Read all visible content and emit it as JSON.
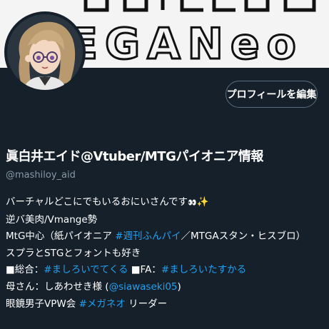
{
  "banner": {
    "logo_text": "EGANeo"
  },
  "profile": {
    "edit_button_label": "プロフィールを編集",
    "display_name": "眞白井エイド@Vtuber/MTGパイオニア情報",
    "handle": "@mashiloy_aid"
  },
  "bio": {
    "line1_text": "バーチャルどこにでもいるおにいさんです",
    "line1_emoji_eyes": "👀",
    "line1_emoji_sparkle": "✨",
    "line2": "逆バ美肉/Vmange勢",
    "line3_pre": "MtG中心（紙パイオニア ",
    "line3_link": "#週刊ふんパイ",
    "line3_post": "／MTGAスタン・ヒスブロ）",
    "line4": "スプラとSTGとフォントも好き",
    "line5_label1": "■総合：",
    "line5_link1": "#ましろいでてくる",
    "line5_label2": " ■FA：",
    "line5_link2": "#ましろいたすかる",
    "line6_pre": "母さん：しあわせき様 (",
    "line6_link": "@siawaseki05",
    "line6_post": ")",
    "line7_pre": "眼鏡男子VPW会 ",
    "line7_link": "#メガネオ",
    "line7_post": " リーダー"
  },
  "colors": {
    "background": "#15202b",
    "link": "#1da1f2",
    "secondary_text": "#8899a6",
    "button_border": "#5c6e7e"
  }
}
